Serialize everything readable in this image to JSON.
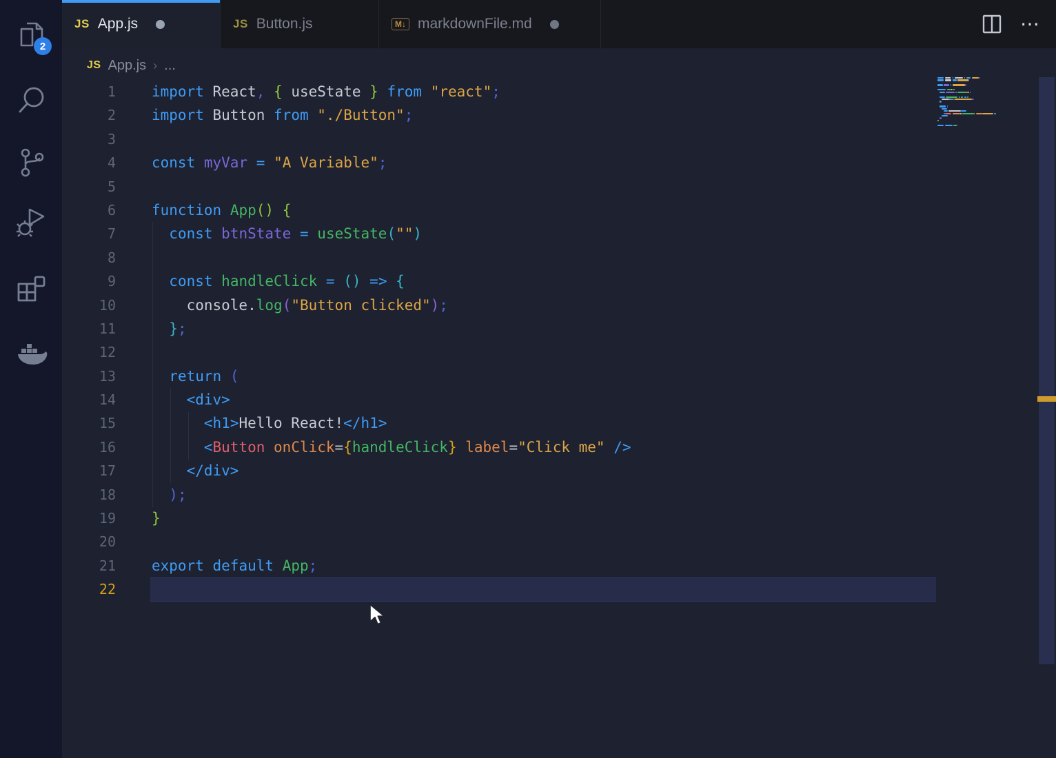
{
  "palette": {
    "kw": "#3f9cf5",
    "id": "#c6cbd4",
    "green": "#45b564",
    "purple": "#7a68d8",
    "violet": "#8a63d2",
    "str": "#dda546",
    "semi": "#5263d6",
    "lime": "#93c83c",
    "teal": "#3ab5c7",
    "gold": "#d7a21a",
    "red": "#e25f6b",
    "attr": "#e0894a",
    "tag": "#3f9cf5",
    "accent_blue": "#3f9cf5",
    "badge_blue": "#2f7fe8",
    "active_line_number": "#d7a21a",
    "js_icon_yellow": "#e3cf4b",
    "md_icon_orange": "#c08c3e"
  },
  "activity_bar": {
    "badge_count": "2",
    "icons": [
      "explorer-icon",
      "search-icon",
      "source-control-icon",
      "run-debug-icon",
      "extensions-icon",
      "docker-icon"
    ]
  },
  "tabs": [
    {
      "label": "App.js",
      "icon": "JS",
      "modified": true,
      "active": true
    },
    {
      "label": "Button.js",
      "icon": "JS",
      "modified": false,
      "active": false
    },
    {
      "label": "markdownFile.md",
      "icon": "M↓",
      "modified": true,
      "active": false
    }
  ],
  "editor_actions": {
    "split_editor": "split-editor-icon",
    "more": "⋯"
  },
  "breadcrumb": {
    "icon": "JS",
    "file": "App.js",
    "separator": "›",
    "symbol": "..."
  },
  "code": {
    "active_line": 22,
    "lines": [
      {
        "n": 1,
        "tokens": [
          [
            0,
            "import",
            "kw"
          ],
          [
            1,
            "React",
            "id"
          ],
          [
            0,
            ",",
            "semi"
          ],
          [
            1,
            "{",
            "lime"
          ],
          [
            1,
            "useState",
            "id"
          ],
          [
            1,
            "}",
            "lime"
          ],
          [
            1,
            "from",
            "kw"
          ],
          [
            1,
            "\"react\"",
            "str"
          ],
          [
            0,
            ";",
            "semi"
          ]
        ]
      },
      {
        "n": 2,
        "tokens": [
          [
            0,
            "import",
            "kw"
          ],
          [
            1,
            "Button",
            "id"
          ],
          [
            1,
            "from",
            "kw"
          ],
          [
            1,
            "\"./Button\"",
            "str"
          ],
          [
            0,
            ";",
            "semi"
          ]
        ]
      },
      {
        "n": 3,
        "tokens": []
      },
      {
        "n": 4,
        "tokens": [
          [
            0,
            "const",
            "kw"
          ],
          [
            1,
            "myVar",
            "purple"
          ],
          [
            1,
            "=",
            "kw"
          ],
          [
            1,
            "\"A Variable\"",
            "str"
          ],
          [
            0,
            ";",
            "semi"
          ]
        ]
      },
      {
        "n": 5,
        "tokens": []
      },
      {
        "n": 6,
        "tokens": [
          [
            0,
            "function",
            "kw"
          ],
          [
            1,
            "App",
            "green"
          ],
          [
            0,
            "()",
            "lime"
          ],
          [
            1,
            "{",
            "lime"
          ]
        ]
      },
      {
        "n": 7,
        "tokens": [
          [
            2,
            "const",
            "kw"
          ],
          [
            1,
            "btnState",
            "purple"
          ],
          [
            1,
            "=",
            "kw"
          ],
          [
            1,
            "useState",
            "green"
          ],
          [
            0,
            "(",
            "teal"
          ],
          [
            0,
            "\"\"",
            "str"
          ],
          [
            0,
            ")",
            "teal"
          ]
        ]
      },
      {
        "n": 8,
        "tokens": []
      },
      {
        "n": 9,
        "tokens": [
          [
            2,
            "const",
            "kw"
          ],
          [
            1,
            "handleClick",
            "green"
          ],
          [
            1,
            "=",
            "kw"
          ],
          [
            1,
            "()",
            "teal"
          ],
          [
            1,
            "=>",
            "kw"
          ],
          [
            1,
            "{",
            "teal"
          ]
        ]
      },
      {
        "n": 10,
        "tokens": [
          [
            4,
            "console",
            "id"
          ],
          [
            0,
            ".",
            "id"
          ],
          [
            0,
            "log",
            "green"
          ],
          [
            0,
            "(",
            "violet"
          ],
          [
            0,
            "\"Button clicked\"",
            "str"
          ],
          [
            0,
            ")",
            "violet"
          ],
          [
            0,
            ";",
            "semi"
          ]
        ]
      },
      {
        "n": 11,
        "tokens": [
          [
            2,
            "}",
            "teal"
          ],
          [
            0,
            ";",
            "semi"
          ]
        ]
      },
      {
        "n": 12,
        "tokens": []
      },
      {
        "n": 13,
        "tokens": [
          [
            2,
            "return",
            "kw"
          ],
          [
            1,
            "(",
            "semi"
          ]
        ]
      },
      {
        "n": 14,
        "tokens": [
          [
            4,
            "<div>",
            "tag"
          ]
        ]
      },
      {
        "n": 15,
        "tokens": [
          [
            6,
            "<h1>",
            "tag"
          ],
          [
            0,
            "Hello React!",
            "id"
          ],
          [
            0,
            "</h1>",
            "tag"
          ]
        ]
      },
      {
        "n": 16,
        "tokens": [
          [
            6,
            "<",
            "tag"
          ],
          [
            0,
            "Button",
            "red"
          ],
          [
            1,
            "onClick",
            "attr"
          ],
          [
            0,
            "=",
            "id"
          ],
          [
            0,
            "{",
            "gold"
          ],
          [
            0,
            "handleClick",
            "green"
          ],
          [
            0,
            "}",
            "gold"
          ],
          [
            1,
            "label",
            "attr"
          ],
          [
            0,
            "=",
            "id"
          ],
          [
            0,
            "\"Click me\"",
            "str"
          ],
          [
            1,
            "/>",
            "tag"
          ]
        ]
      },
      {
        "n": 17,
        "tokens": [
          [
            4,
            "</div>",
            "tag"
          ]
        ]
      },
      {
        "n": 18,
        "tokens": [
          [
            2,
            ")",
            "semi"
          ],
          [
            0,
            ";",
            "semi"
          ]
        ]
      },
      {
        "n": 19,
        "tokens": [
          [
            0,
            "}",
            "lime"
          ]
        ]
      },
      {
        "n": 20,
        "tokens": []
      },
      {
        "n": 21,
        "tokens": [
          [
            0,
            "export",
            "kw"
          ],
          [
            1,
            "default",
            "kw"
          ],
          [
            1,
            "App",
            "green"
          ],
          [
            0,
            ";",
            "semi"
          ]
        ]
      },
      {
        "n": 22,
        "tokens": []
      }
    ]
  }
}
